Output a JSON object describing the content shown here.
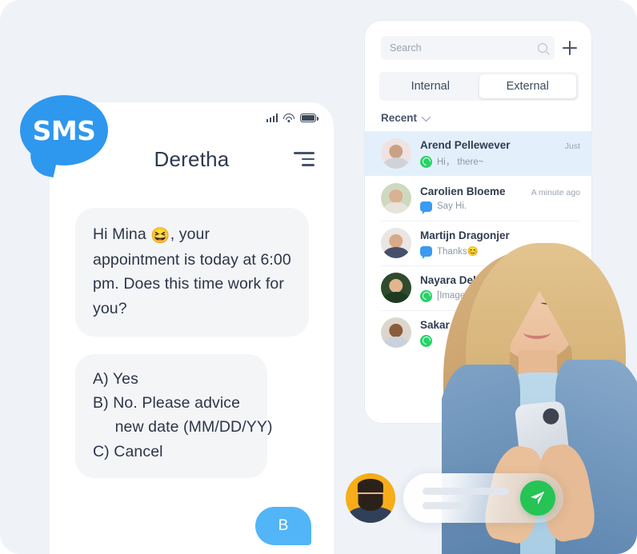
{
  "page": {
    "background_color": "#eff2f7",
    "accent_blue": "#2e97ee",
    "accent_green": "#25c454"
  },
  "logo": {
    "text": "SMS",
    "icon": "sms-speech-bubble-icon",
    "color": "#2e97ee"
  },
  "phone": {
    "status_bar": {
      "signal_icon": "signal-bars-icon",
      "wifi_icon": "wifi-icon",
      "battery_icon": "battery-icon"
    },
    "header": {
      "title": "Deretha",
      "menu_icon": "hamburger-menu-icon"
    },
    "messages": [
      {
        "id": "msg-appointment",
        "direction": "incoming",
        "text_before_emoji": "Hi Mina ",
        "emoji": "😆",
        "text_after_emoji": ", your appointment is today at 6:00 pm. Does this time work for you?"
      },
      {
        "id": "msg-options",
        "direction": "incoming",
        "text": "A) Yes\nB) No. Please advice\n     new date (MM/DD/YY)\nC) Cancel"
      },
      {
        "id": "msg-reply",
        "direction": "outgoing",
        "text": "B"
      }
    ]
  },
  "contacts_panel": {
    "search": {
      "placeholder": "Search",
      "value": "",
      "search_icon": "search-icon",
      "add_icon": "plus-icon"
    },
    "tabs": [
      {
        "label": "Internal",
        "active": false
      },
      {
        "label": "External",
        "active": true
      }
    ],
    "section": {
      "label": "Recent",
      "chevron_icon": "chevron-down-icon"
    },
    "conversations": [
      {
        "name": "Arend Pellewever",
        "time": "Just",
        "channel": "whatsapp",
        "preview": "Hi， there~",
        "selected": true,
        "avatar_colors": {
          "bg": "#efe3e2",
          "skin": "#caa184",
          "body": "#cfd3d8"
        }
      },
      {
        "name": "Carolien Bloeme",
        "time": "A minute ago",
        "channel": "sms",
        "preview": "Say Hi.",
        "selected": false,
        "avatar_colors": {
          "bg": "#cfd9bf",
          "skin": "#d9b193",
          "body": "#e8e4dc"
        }
      },
      {
        "name": "Martijn Dragonjer",
        "time": "",
        "channel": "sms",
        "preview": "Thanks😊",
        "selected": false,
        "avatar_colors": {
          "bg": "#e9e6e3",
          "skin": "#d8aa87",
          "body": "#46506b"
        }
      },
      {
        "name": "Nayara Delafue",
        "time": "",
        "channel": "whatsapp",
        "preview": "[Image][Image]",
        "selected": false,
        "avatar_colors": {
          "bg": "#2f4a2c",
          "skin": "#e2b58f",
          "body": "#1d3a22"
        }
      },
      {
        "name": "Sakar",
        "time": "",
        "channel": "whatsapp",
        "preview": "",
        "selected": false,
        "avatar_colors": {
          "bg": "#ddd6cd",
          "skin": "#8a5b3c",
          "body": "#c9d2dc"
        }
      }
    ]
  },
  "composer": {
    "avatar_name": "user-avatar",
    "avatar_bg": "#f7ad19",
    "input_placeholder": "",
    "send_icon": "send-paper-plane-icon",
    "send_color": "#25c454"
  },
  "photo": {
    "subject": "woman-holding-phone-photo"
  }
}
